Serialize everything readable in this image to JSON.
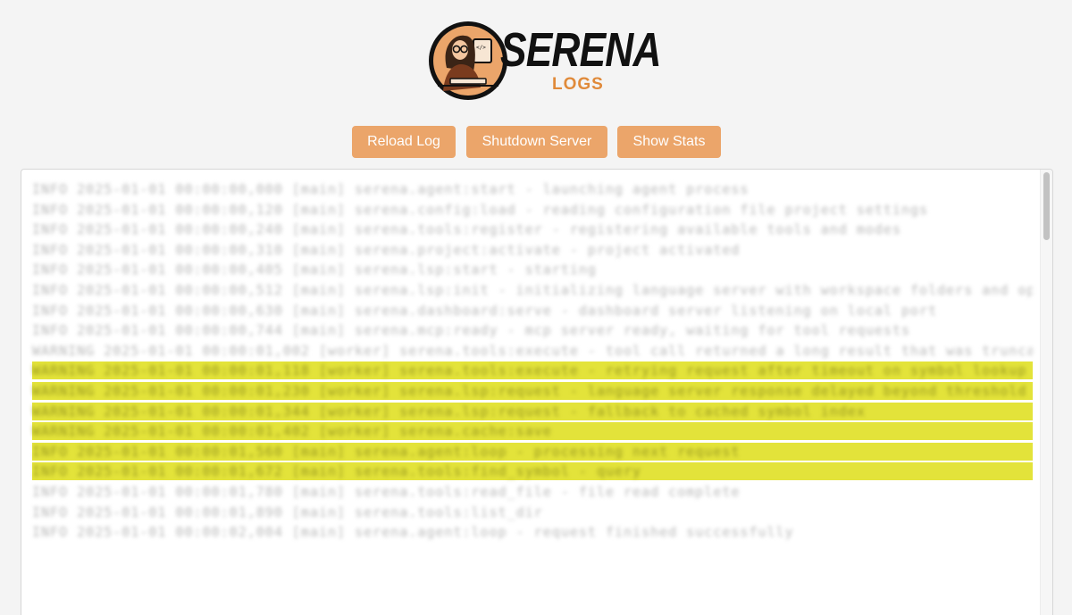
{
  "logo": {
    "word": "SERENA",
    "subtitle": "LOGS",
    "avatar_icon": "woman-at-computer-icon",
    "accent": "#e08a3a"
  },
  "toolbar": {
    "reload_label": "Reload Log",
    "shutdown_label": "Shutdown Server",
    "stats_label": "Show Stats",
    "button_color": "#eba56a"
  },
  "log": {
    "highlight_color": "#e3e33a",
    "lines": [
      "INFO  2025-01-01 00:00:00,000 [main] serena.agent:start - launching agent process",
      "INFO  2025-01-01 00:00:00,120 [main] serena.config:load - reading configuration file project settings",
      "INFO  2025-01-01 00:00:00,240 [main] serena.tools:register - registering available tools and modes",
      "INFO  2025-01-01 00:00:00,310 [main] serena.project:activate - project activated",
      "INFO  2025-01-01 00:00:00,405 [main] serena.lsp:start - starting",
      "INFO  2025-01-01 00:00:00,512 [main] serena.lsp:init - initializing language server with workspace folders and options",
      "INFO  2025-01-01 00:00:00,630 [main] serena.dashboard:serve - dashboard server listening on local port",
      "INFO  2025-01-01 00:00:00,744 [main] serena.mcp:ready - mcp server ready, waiting for tool requests",
      "WARNING 2025-01-01 00:00:01,002 [worker] serena.tools:execute - tool call returned a long result that was truncated",
      "WARNING 2025-01-01 00:00:01,118 [worker] serena.tools:execute - retrying request after timeout on symbol lookup",
      "WARNING 2025-01-01 00:00:01,230 [worker] serena.lsp:request - language server response delayed beyond threshold",
      "WARNING 2025-01-01 00:00:01,344 [worker] serena.lsp:request - fallback to cached symbol index",
      "WARNING 2025-01-01 00:00:01,402 [worker] serena.cache:save",
      "INFO  2025-01-01 00:00:01,560 [main] serena.agent:loop - processing next request",
      "INFO  2025-01-01 00:00:01,672 [main] serena.tools:find_symbol - query",
      "INFO  2025-01-01 00:00:01,780 [main] serena.tools:read_file - file read complete",
      "INFO  2025-01-01 00:00:01,890 [main] serena.tools:list_dir",
      "INFO  2025-01-01 00:00:02,004 [main] serena.agent:loop - request finished successfully"
    ],
    "highlighted_indices": [
      9,
      10,
      11,
      12,
      13,
      14
    ]
  }
}
